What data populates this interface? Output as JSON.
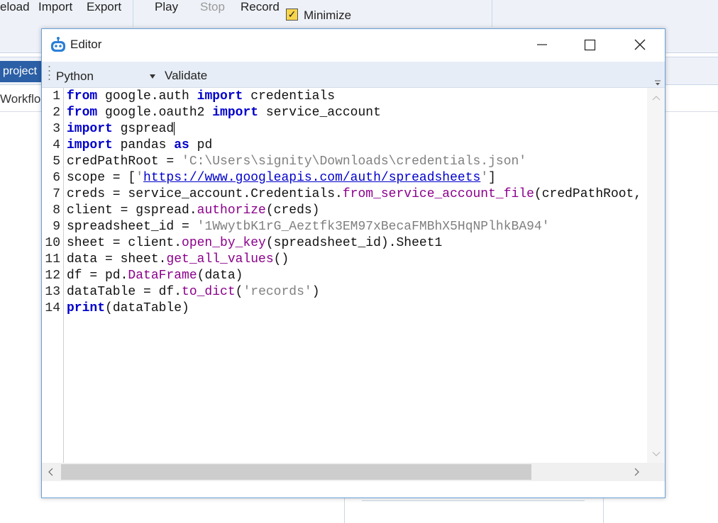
{
  "background": {
    "toolbar_buttons": [
      {
        "label": "eload",
        "disabled": false
      },
      {
        "label": "Import",
        "disabled": false
      },
      {
        "label": "Export",
        "disabled": false
      },
      {
        "label": "Play",
        "disabled": false
      },
      {
        "label": "Stop",
        "disabled": true
      },
      {
        "label": "Record",
        "disabled": false
      }
    ],
    "minimize_label": "Minimize",
    "minimize_checked": true,
    "project_tab": "project",
    "workflow_label": "Workflo"
  },
  "editor": {
    "title": "Editor",
    "language": "Python",
    "validate_label": "Validate",
    "line_numbers": [
      "1",
      "2",
      "3",
      "4",
      "5",
      "6",
      "7",
      "8",
      "9",
      "10",
      "11",
      "12",
      "13",
      "14"
    ],
    "lines": [
      [
        {
          "t": "kw",
          "v": "from"
        },
        {
          "t": "p",
          "v": " google.auth "
        },
        {
          "t": "kw",
          "v": "import"
        },
        {
          "t": "p",
          "v": " credentials"
        }
      ],
      [
        {
          "t": "kw",
          "v": "from"
        },
        {
          "t": "p",
          "v": " google.oauth2 "
        },
        {
          "t": "kw",
          "v": "import"
        },
        {
          "t": "p",
          "v": " service_account"
        }
      ],
      [
        {
          "t": "kw",
          "v": "import"
        },
        {
          "t": "p",
          "v": " gspread"
        },
        {
          "t": "cursor",
          "v": ""
        }
      ],
      [
        {
          "t": "kw",
          "v": "import"
        },
        {
          "t": "p",
          "v": " pandas "
        },
        {
          "t": "kw",
          "v": "as"
        },
        {
          "t": "p",
          "v": " pd"
        }
      ],
      [
        {
          "t": "p",
          "v": "credPathRoot = "
        },
        {
          "t": "str",
          "v": "'C:\\Users\\signity\\Downloads\\credentials.json'"
        }
      ],
      [
        {
          "t": "p",
          "v": "scope = ["
        },
        {
          "t": "str",
          "v": "'"
        },
        {
          "t": "url",
          "v": "https://www.googleapis.com/auth/spreadsheets"
        },
        {
          "t": "str",
          "v": "'"
        },
        {
          "t": "p",
          "v": "]"
        }
      ],
      [
        {
          "t": "p",
          "v": "creds = service_account.Credentials."
        },
        {
          "t": "fn",
          "v": "from_service_account_file"
        },
        {
          "t": "p",
          "v": "(credPathRoot,"
        }
      ],
      [
        {
          "t": "p",
          "v": "client = gspread."
        },
        {
          "t": "fn",
          "v": "authorize"
        },
        {
          "t": "p",
          "v": "(creds)"
        }
      ],
      [
        {
          "t": "p",
          "v": "spreadsheet_id = "
        },
        {
          "t": "str",
          "v": "'1WwytbK1rG_Aeztfk3EM97xBecaFMBhX5HqNPlhkBA94'"
        }
      ],
      [
        {
          "t": "p",
          "v": "sheet = client."
        },
        {
          "t": "fn",
          "v": "open_by_key"
        },
        {
          "t": "p",
          "v": "(spreadsheet_id).Sheet1"
        }
      ],
      [
        {
          "t": "p",
          "v": "data = sheet."
        },
        {
          "t": "fn",
          "v": "get_all_values"
        },
        {
          "t": "p",
          "v": "()"
        }
      ],
      [
        {
          "t": "p",
          "v": "df = pd."
        },
        {
          "t": "fn",
          "v": "DataFrame"
        },
        {
          "t": "p",
          "v": "(data)"
        }
      ],
      [
        {
          "t": "p",
          "v": "dataTable = df."
        },
        {
          "t": "fn",
          "v": "to_dict"
        },
        {
          "t": "p",
          "v": "("
        },
        {
          "t": "str",
          "v": "'records'"
        },
        {
          "t": "p",
          "v": ")"
        }
      ],
      [
        {
          "t": "kw",
          "v": "print"
        },
        {
          "t": "p",
          "v": "(dataTable)"
        }
      ]
    ]
  },
  "colors": {
    "keyword": "#0000cc",
    "function": "#8b008b",
    "string": "#808080",
    "accent": "#2b5fa6",
    "window_border": "#6aa0d8"
  },
  "icons": [
    "robot-app-icon",
    "minimize-icon",
    "maximize-icon",
    "close-icon",
    "chevron-down-icon",
    "chevron-left-icon",
    "chevron-right-icon",
    "chevron-up-icon"
  ]
}
